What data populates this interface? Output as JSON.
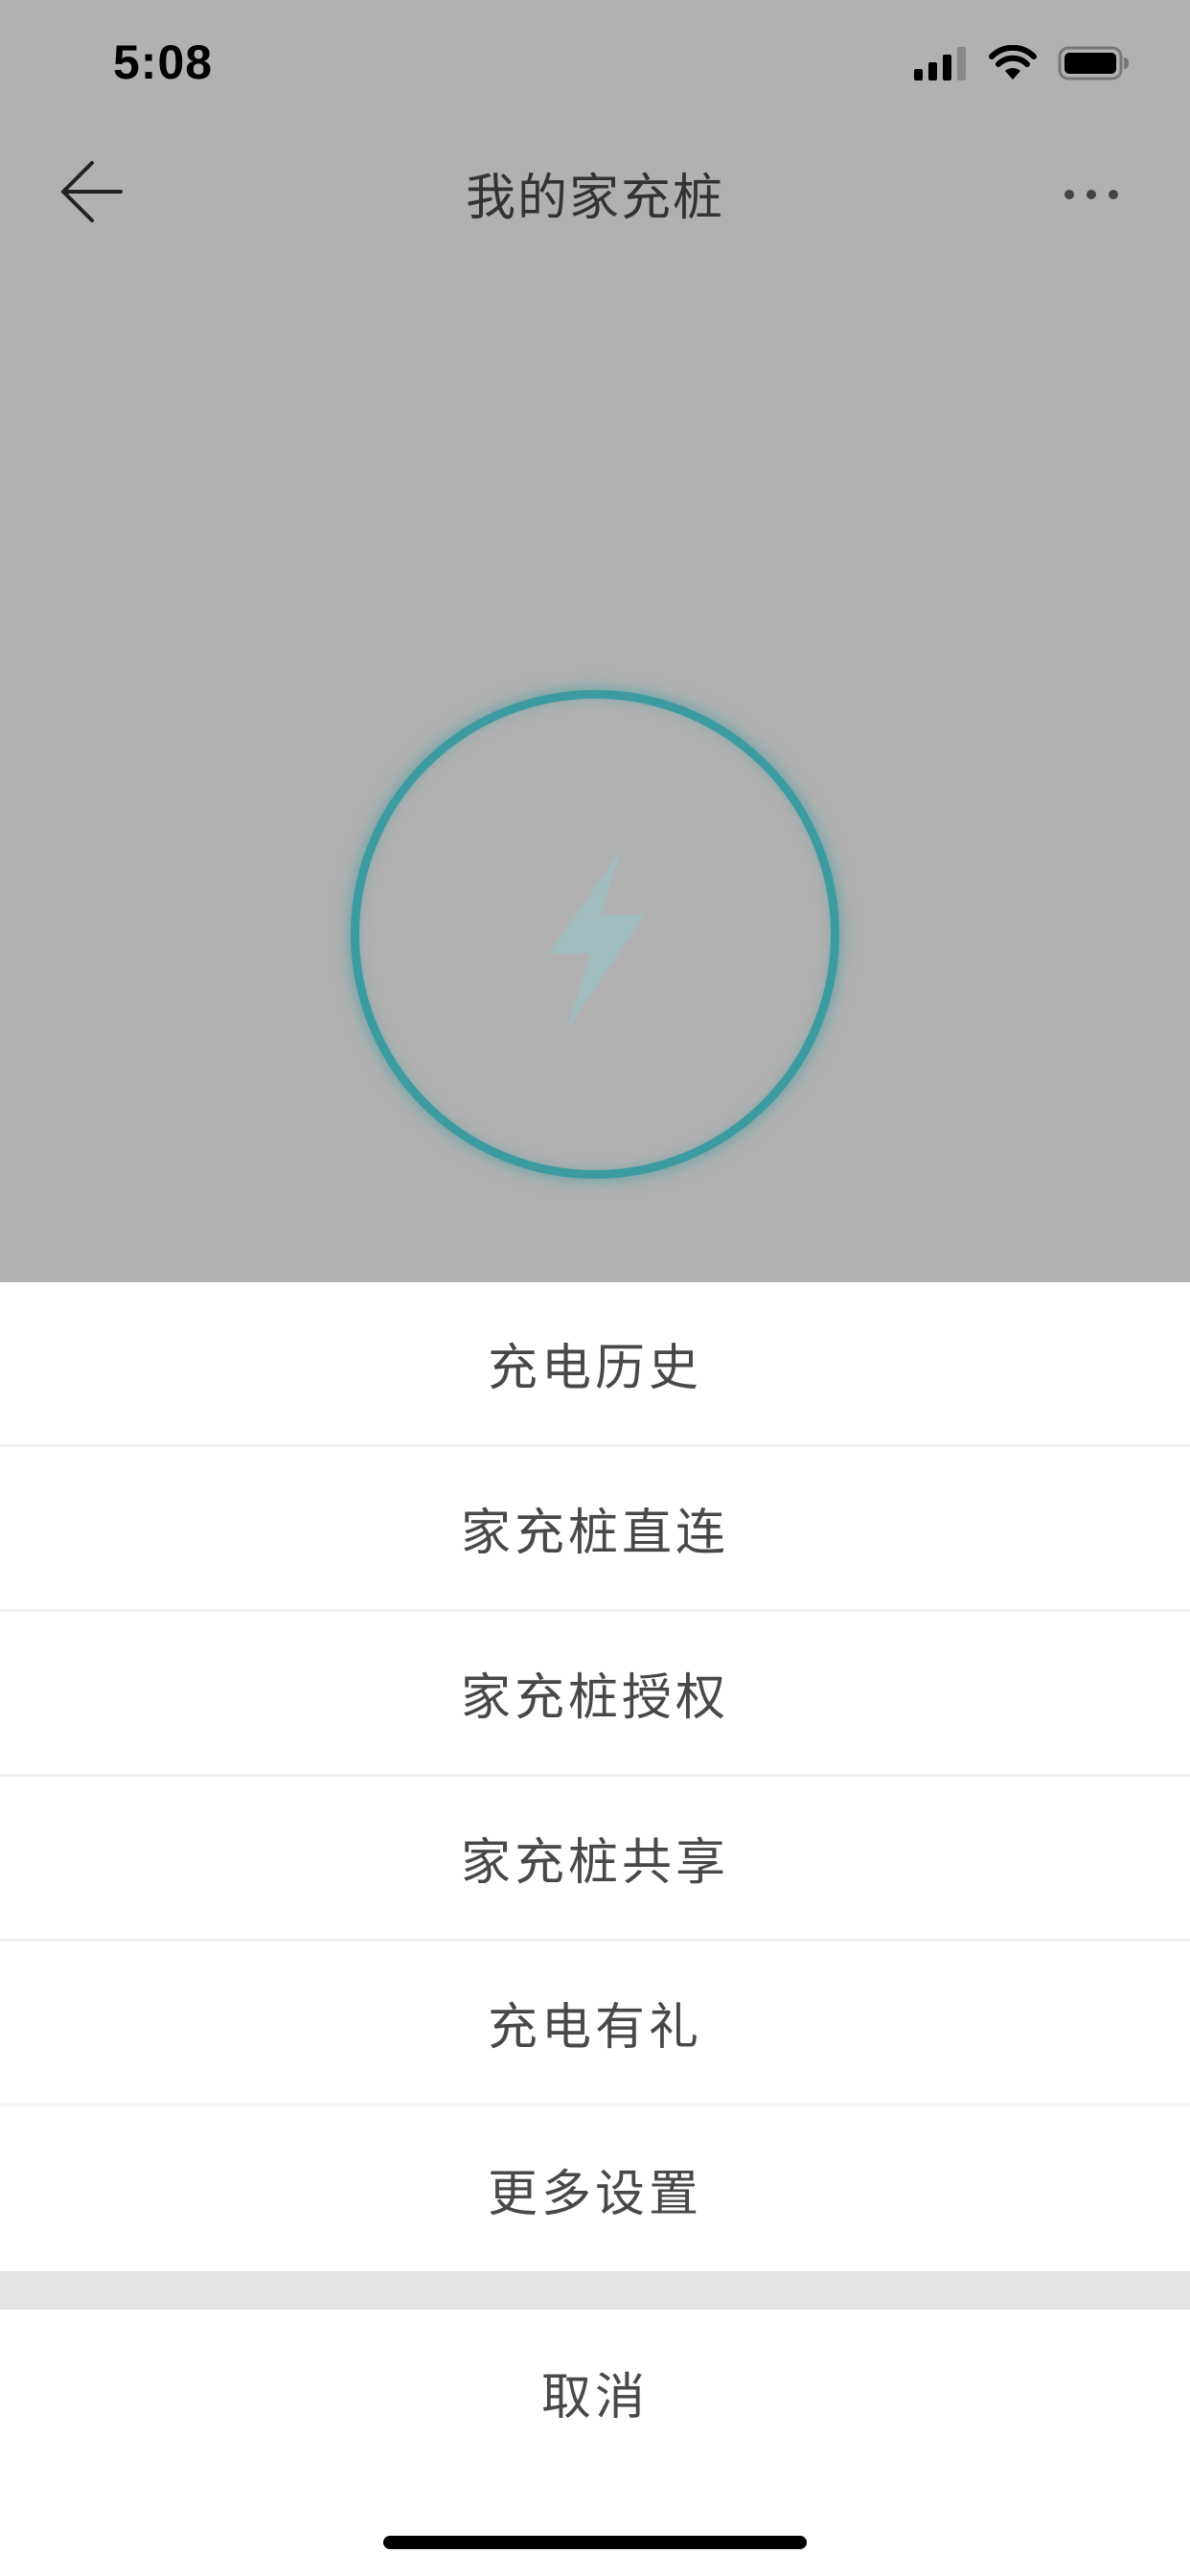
{
  "status_bar": {
    "time": "5:08",
    "icons": [
      "cellular-signal-icon",
      "wifi-icon",
      "battery-icon"
    ]
  },
  "nav": {
    "title": "我的家充桩",
    "back_icon": "back-arrow-icon",
    "more_icon": "more-icon"
  },
  "charger": {
    "icon": "lightning-bolt-icon",
    "ring_color": "#3c9ba0"
  },
  "action_sheet": {
    "items": [
      {
        "label": "充电历史"
      },
      {
        "label": "家充桩直连"
      },
      {
        "label": "家充桩授权"
      },
      {
        "label": "家充桩共享"
      },
      {
        "label": "充电有礼"
      },
      {
        "label": "更多设置"
      }
    ],
    "cancel_label": "取消"
  },
  "colors": {
    "overlay_background": "#b1b1b1",
    "sheet_background": "#ffffff",
    "accent": "#3c9ba0"
  }
}
